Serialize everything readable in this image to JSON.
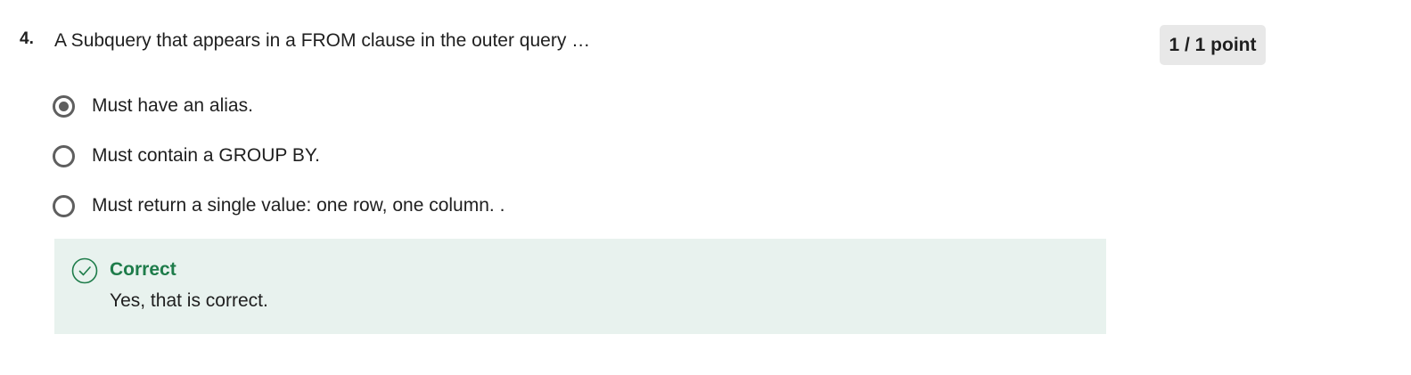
{
  "question": {
    "number": "4.",
    "text": "A Subquery that appears in a FROM clause in the outer query …",
    "points": "1 / 1 point"
  },
  "options": [
    {
      "label": "Must have an alias.",
      "selected": true
    },
    {
      "label": "Must contain a GROUP BY.",
      "selected": false
    },
    {
      "label": "Must return a single value: one row, one column. .",
      "selected": false
    }
  ],
  "feedback": {
    "status": "Correct",
    "message": "Yes, that is correct.",
    "icon": "check-circle-icon"
  },
  "colors": {
    "correct_green": "#1e7c4a",
    "feedback_background": "#e8f2ee",
    "badge_background": "#e8e8e8",
    "radio_gray": "#5f5f5f"
  }
}
